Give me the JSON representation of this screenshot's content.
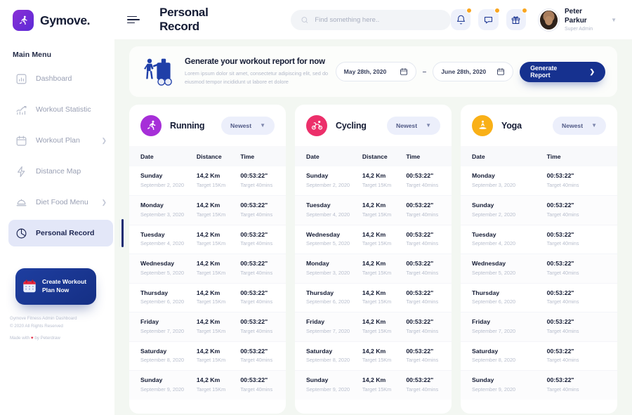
{
  "brand": {
    "name": "Gymove.",
    "logo_icon": "runner-icon"
  },
  "sidebar": {
    "menu_label": "Main Menu",
    "items": [
      {
        "label": "Dashboard",
        "icon": "chart-bar-icon",
        "has_arrow": false,
        "active": false
      },
      {
        "label": "Workout Statistic",
        "icon": "trend-up-icon",
        "has_arrow": false,
        "active": false
      },
      {
        "label": "Workout Plan",
        "icon": "calendar-icon",
        "has_arrow": true,
        "active": false
      },
      {
        "label": "Distance Map",
        "icon": "bolt-icon",
        "has_arrow": false,
        "active": false
      },
      {
        "label": "Diet Food Menu",
        "icon": "food-cloche-icon",
        "has_arrow": true,
        "active": false
      },
      {
        "label": "Personal Record",
        "icon": "pie-chart-icon",
        "has_arrow": false,
        "active": true
      }
    ],
    "promo": {
      "line1": "Create Workout",
      "line2": "Plan Now",
      "icon": "calendar-color-icon"
    },
    "footer": {
      "line1": "Gymove Fitness Admin Dashboard",
      "line2": "© 2020 All Rights Reserved",
      "made_prefix": "Made with ",
      "made_heart": "♥",
      "made_suffix": " by Peterdraw"
    }
  },
  "topbar": {
    "menu_icon": "hamburger-icon",
    "title": "Personal Record",
    "search": {
      "placeholder": "Find something here..",
      "value": "",
      "icon": "search-icon"
    },
    "actions": [
      {
        "name": "notifications",
        "icon": "bell-icon",
        "badge": true
      },
      {
        "name": "messages",
        "icon": "chat-icon",
        "badge": true
      },
      {
        "name": "gifts",
        "icon": "gift-icon",
        "badge": true
      }
    ],
    "user": {
      "name": "Peter Parkur",
      "role": "Super Admin",
      "caret_icon": "chevron-down-icon"
    }
  },
  "banner": {
    "illustration": "athletes-illustration",
    "title": "Generate your workout report for now",
    "description": "Lorem ipsum dolor sit amet, consectetur adipiscing elit, sed do eiusmod tempor incididunt ut labore et dolore",
    "date_from": "May 28th, 2020",
    "date_to": "June 28th, 2020",
    "separator": "–",
    "calendar_icon": "calendar-icon",
    "button_label": "Generate Report",
    "button_icon": "chevron-right-icon"
  },
  "colors": {
    "running": "#a62fd8",
    "cycling": "#ec2f6a",
    "yoga": "#f9b017",
    "accent_blue": "#16318f",
    "badge": "#f9a620",
    "page_bg": "#f3f7f2"
  },
  "cards": [
    {
      "sport": "Running",
      "icon": "runner-icon",
      "accent": "#a62fd8",
      "sort_label": "Newest",
      "columns": [
        "Date",
        "Distance",
        "Time"
      ],
      "rows": [
        {
          "day": "Sunday",
          "date": "September 2, 2020",
          "distance": "14,2 Km",
          "distance_target": "Target 15Km",
          "time": "00:53:22\"",
          "time_target": "Target 40mins"
        },
        {
          "day": "Monday",
          "date": "September 3, 2020",
          "distance": "14,2 Km",
          "distance_target": "Target 15Km",
          "time": "00:53:22\"",
          "time_target": "Target 40mins"
        },
        {
          "day": "Tuesday",
          "date": "September 4, 2020",
          "distance": "14,2 Km",
          "distance_target": "Target 15Km",
          "time": "00:53:22\"",
          "time_target": "Target 40mins"
        },
        {
          "day": "Wednesday",
          "date": "September 5, 2020",
          "distance": "14,2 Km",
          "distance_target": "Target 15Km",
          "time": "00:53:22\"",
          "time_target": "Target 40mins"
        },
        {
          "day": "Thursday",
          "date": "September 6, 2020",
          "distance": "14,2 Km",
          "distance_target": "Target 15Km",
          "time": "00:53:22\"",
          "time_target": "Target 40mins"
        },
        {
          "day": "Friday",
          "date": "September 7, 2020",
          "distance": "14,2 Km",
          "distance_target": "Target 15Km",
          "time": "00:53:22\"",
          "time_target": "Target 40mins"
        },
        {
          "day": "Saturday",
          "date": "September 8, 2020",
          "distance": "14,2 Km",
          "distance_target": "Target 15Km",
          "time": "00:53:22\"",
          "time_target": "Target 40mins"
        },
        {
          "day": "Sunday",
          "date": "September 9, 2020",
          "distance": "14,2 Km",
          "distance_target": "Target 15Km",
          "time": "00:53:22\"",
          "time_target": "Target 40mins"
        }
      ]
    },
    {
      "sport": "Cycling",
      "icon": "cycling-icon",
      "accent": "#ec2f6a",
      "sort_label": "Newest",
      "columns": [
        "Date",
        "Distance",
        "Time"
      ],
      "rows": [
        {
          "day": "Sunday",
          "date": "September 2, 2020",
          "distance": "14,2 Km",
          "distance_target": "Target 15Km",
          "time": "00:53:22\"",
          "time_target": "Target 40mins"
        },
        {
          "day": "Tuesday",
          "date": "September 4, 2020",
          "distance": "14,2 Km",
          "distance_target": "Target 15Km",
          "time": "00:53:22\"",
          "time_target": "Target 40mins"
        },
        {
          "day": "Wednesday",
          "date": "September 5, 2020",
          "distance": "14,2 Km",
          "distance_target": "Target 15Km",
          "time": "00:53:22\"",
          "time_target": "Target 40mins"
        },
        {
          "day": "Monday",
          "date": "September 3, 2020",
          "distance": "14,2 Km",
          "distance_target": "Target 15Km",
          "time": "00:53:22\"",
          "time_target": "Target 40mins"
        },
        {
          "day": "Thursday",
          "date": "September 6, 2020",
          "distance": "14,2 Km",
          "distance_target": "Target 15Km",
          "time": "00:53:22\"",
          "time_target": "Target 40mins"
        },
        {
          "day": "Friday",
          "date": "September 7, 2020",
          "distance": "14,2 Km",
          "distance_target": "Target 15Km",
          "time": "00:53:22\"",
          "time_target": "Target 40mins"
        },
        {
          "day": "Saturday",
          "date": "September 8, 2020",
          "distance": "14,2 Km",
          "distance_target": "Target 15Km",
          "time": "00:53:22\"",
          "time_target": "Target 40mins"
        },
        {
          "day": "Sunday",
          "date": "September 9, 2020",
          "distance": "14,2 Km",
          "distance_target": "Target 15Km",
          "time": "00:53:22\"",
          "time_target": "Target 40mins"
        }
      ]
    },
    {
      "sport": "Yoga",
      "icon": "yoga-icon",
      "accent": "#f9b017",
      "sort_label": "Newest",
      "columns": [
        "Date",
        "Time"
      ],
      "rows": [
        {
          "day": "Monday",
          "date": "September 3, 2020",
          "time": "00:53:22\"",
          "time_target": "Target 40mins"
        },
        {
          "day": "Sunday",
          "date": "September 2, 2020",
          "time": "00:53:22\"",
          "time_target": "Target 40mins"
        },
        {
          "day": "Tuesday",
          "date": "September 4, 2020",
          "time": "00:53:22\"",
          "time_target": "Target 40mins"
        },
        {
          "day": "Wednesday",
          "date": "September 5, 2020",
          "time": "00:53:22\"",
          "time_target": "Target 40mins"
        },
        {
          "day": "Thursday",
          "date": "September 6, 2020",
          "time": "00:53:22\"",
          "time_target": "Target 40mins"
        },
        {
          "day": "Friday",
          "date": "September 7, 2020",
          "time": "00:53:22\"",
          "time_target": "Target 40mins"
        },
        {
          "day": "Saturday",
          "date": "September 8, 2020",
          "time": "00:53:22\"",
          "time_target": "Target 40mins"
        },
        {
          "day": "Sunday",
          "date": "September 9, 2020",
          "time": "00:53:22\"",
          "time_target": "Target 40mins"
        }
      ]
    }
  ]
}
